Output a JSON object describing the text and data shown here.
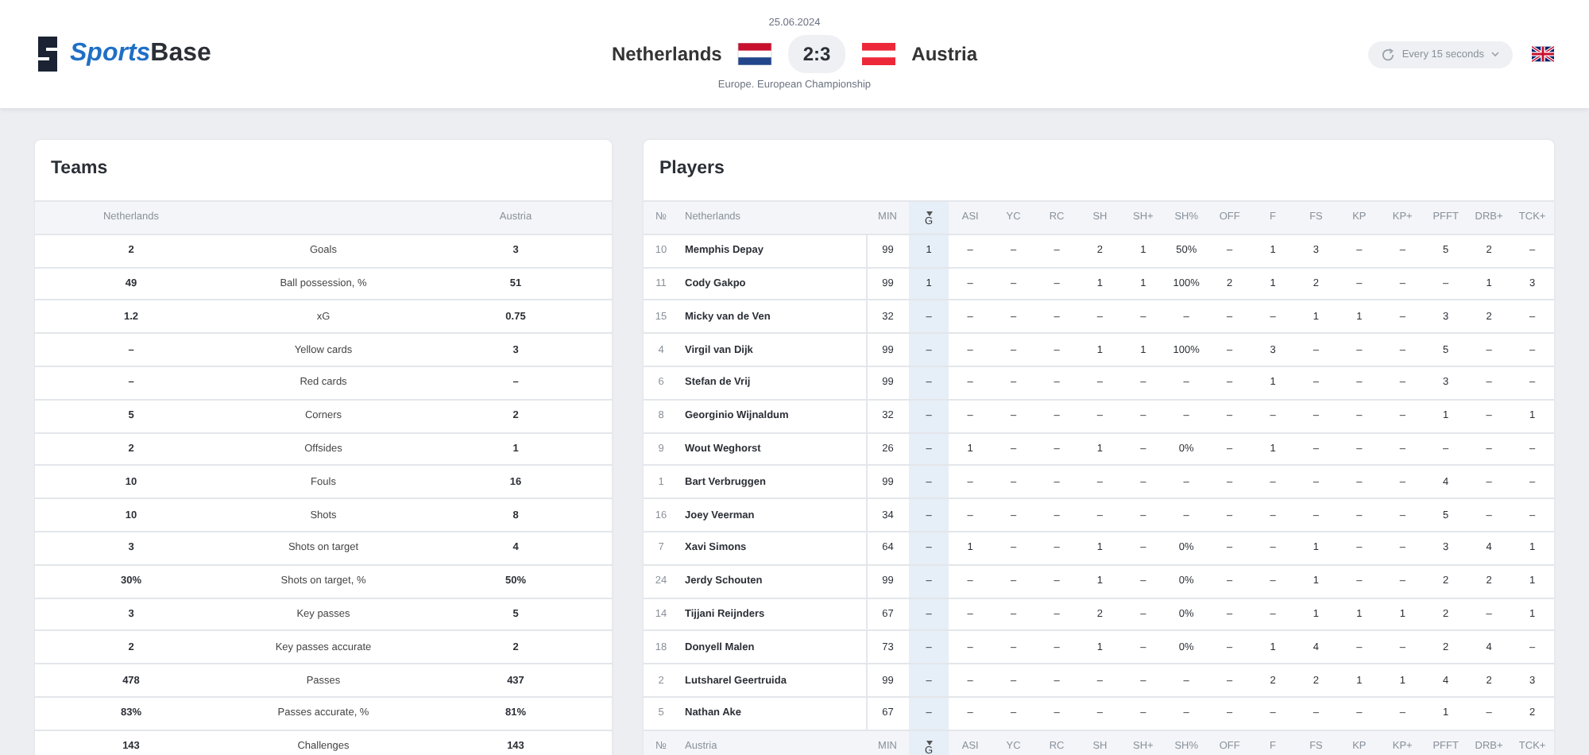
{
  "header": {
    "logo": {
      "first": "Sports",
      "second": "Base"
    },
    "date": "25.06.2024",
    "home_team": "Netherlands",
    "score": "2:3",
    "away_team": "Austria",
    "competition": "Europe. European Championship",
    "refresh": "Every 15 seconds"
  },
  "teams": {
    "title": "Teams",
    "home_label": "Netherlands",
    "away_label": "Austria",
    "rows": [
      {
        "home": "2",
        "stat": "Goals",
        "away": "3"
      },
      {
        "home": "49",
        "stat": "Ball possession, %",
        "away": "51"
      },
      {
        "home": "1.2",
        "stat": "xG",
        "away": "0.75"
      },
      {
        "home": "–",
        "stat": "Yellow cards",
        "away": "3"
      },
      {
        "home": "–",
        "stat": "Red cards",
        "away": "–"
      },
      {
        "home": "5",
        "stat": "Corners",
        "away": "2"
      },
      {
        "home": "2",
        "stat": "Offsides",
        "away": "1"
      },
      {
        "home": "10",
        "stat": "Fouls",
        "away": "16"
      },
      {
        "home": "10",
        "stat": "Shots",
        "away": "8"
      },
      {
        "home": "3",
        "stat": "Shots on target",
        "away": "4"
      },
      {
        "home": "30%",
        "stat": "Shots on target, %",
        "away": "50%"
      },
      {
        "home": "3",
        "stat": "Key passes",
        "away": "5"
      },
      {
        "home": "2",
        "stat": "Key passes accurate",
        "away": "2"
      },
      {
        "home": "478",
        "stat": "Passes",
        "away": "437"
      },
      {
        "home": "83%",
        "stat": "Passes accurate, %",
        "away": "81%"
      },
      {
        "home": "143",
        "stat": "Challenges",
        "away": "143"
      }
    ]
  },
  "players": {
    "title": "Players",
    "home": {
      "columns": [
        {
          "label": "№",
          "sorted": false
        },
        {
          "label": "Netherlands",
          "sorted": false
        },
        {
          "label": "MIN",
          "sorted": false
        },
        {
          "label": "G",
          "sorted": true
        },
        {
          "label": "ASI",
          "sorted": false
        },
        {
          "label": "YC",
          "sorted": false
        },
        {
          "label": "RC",
          "sorted": false
        },
        {
          "label": "SH",
          "sorted": false
        },
        {
          "label": "SH+",
          "sorted": false
        },
        {
          "label": "SH%",
          "sorted": false
        },
        {
          "label": "OFF",
          "sorted": false
        },
        {
          "label": "F",
          "sorted": false
        },
        {
          "label": "FS",
          "sorted": false
        },
        {
          "label": "KP",
          "sorted": false
        },
        {
          "label": "KP+",
          "sorted": false
        },
        {
          "label": "PFFT",
          "sorted": false
        },
        {
          "label": "DRB+",
          "sorted": false
        },
        {
          "label": "TCK+",
          "sorted": false
        }
      ],
      "rows": [
        [
          "10",
          "Memphis Depay",
          "99",
          "1",
          "–",
          "–",
          "–",
          "2",
          "1",
          "50%",
          "–",
          "1",
          "3",
          "–",
          "–",
          "5",
          "2",
          "–"
        ],
        [
          "11",
          "Cody Gakpo",
          "99",
          "1",
          "–",
          "–",
          "–",
          "1",
          "1",
          "100%",
          "2",
          "1",
          "2",
          "–",
          "–",
          "–",
          "1",
          "3"
        ],
        [
          "15",
          "Micky van de Ven",
          "32",
          "–",
          "–",
          "–",
          "–",
          "–",
          "–",
          "–",
          "–",
          "–",
          "1",
          "1",
          "–",
          "3",
          "2",
          "–"
        ],
        [
          "4",
          "Virgil van Dijk",
          "99",
          "–",
          "–",
          "–",
          "–",
          "1",
          "1",
          "100%",
          "–",
          "3",
          "–",
          "–",
          "–",
          "5",
          "–",
          "–"
        ],
        [
          "6",
          "Stefan de Vrij",
          "99",
          "–",
          "–",
          "–",
          "–",
          "–",
          "–",
          "–",
          "–",
          "1",
          "–",
          "–",
          "–",
          "3",
          "–",
          "–"
        ],
        [
          "8",
          "Georginio Wijnaldum",
          "32",
          "–",
          "–",
          "–",
          "–",
          "–",
          "–",
          "–",
          "–",
          "–",
          "–",
          "–",
          "–",
          "1",
          "–",
          "1"
        ],
        [
          "9",
          "Wout Weghorst",
          "26",
          "–",
          "1",
          "–",
          "–",
          "1",
          "–",
          "0%",
          "–",
          "1",
          "–",
          "–",
          "–",
          "–",
          "–",
          "–"
        ],
        [
          "1",
          "Bart Verbruggen",
          "99",
          "–",
          "–",
          "–",
          "–",
          "–",
          "–",
          "–",
          "–",
          "–",
          "–",
          "–",
          "–",
          "4",
          "–",
          "–"
        ],
        [
          "16",
          "Joey Veerman",
          "34",
          "–",
          "–",
          "–",
          "–",
          "–",
          "–",
          "–",
          "–",
          "–",
          "–",
          "–",
          "–",
          "5",
          "–",
          "–"
        ],
        [
          "7",
          "Xavi Simons",
          "64",
          "–",
          "1",
          "–",
          "–",
          "1",
          "–",
          "0%",
          "–",
          "–",
          "1",
          "–",
          "–",
          "3",
          "4",
          "1"
        ],
        [
          "24",
          "Jerdy Schouten",
          "99",
          "–",
          "–",
          "–",
          "–",
          "1",
          "–",
          "0%",
          "–",
          "–",
          "1",
          "–",
          "–",
          "2",
          "2",
          "1"
        ],
        [
          "14",
          "Tijjani Reijnders",
          "67",
          "–",
          "–",
          "–",
          "–",
          "2",
          "–",
          "0%",
          "–",
          "–",
          "1",
          "1",
          "1",
          "2",
          "–",
          "1"
        ],
        [
          "18",
          "Donyell Malen",
          "73",
          "–",
          "–",
          "–",
          "–",
          "1",
          "–",
          "0%",
          "–",
          "1",
          "4",
          "–",
          "–",
          "2",
          "4",
          "–"
        ],
        [
          "2",
          "Lutsharel Geertruida",
          "99",
          "–",
          "–",
          "–",
          "–",
          "–",
          "–",
          "–",
          "–",
          "2",
          "2",
          "1",
          "1",
          "4",
          "2",
          "3"
        ],
        [
          "5",
          "Nathan Ake",
          "67",
          "–",
          "–",
          "–",
          "–",
          "–",
          "–",
          "–",
          "–",
          "–",
          "–",
          "–",
          "–",
          "1",
          "–",
          "2"
        ]
      ]
    },
    "away": {
      "columns": [
        {
          "label": "№",
          "sorted": false
        },
        {
          "label": "Austria",
          "sorted": false
        },
        {
          "label": "MIN",
          "sorted": false
        },
        {
          "label": "G",
          "sorted": true
        },
        {
          "label": "ASI",
          "sorted": false
        },
        {
          "label": "YC",
          "sorted": false
        },
        {
          "label": "RC",
          "sorted": false
        },
        {
          "label": "SH",
          "sorted": false
        },
        {
          "label": "SH+",
          "sorted": false
        },
        {
          "label": "SH%",
          "sorted": false
        },
        {
          "label": "OFF",
          "sorted": false
        },
        {
          "label": "F",
          "sorted": false
        },
        {
          "label": "FS",
          "sorted": false
        },
        {
          "label": "KP",
          "sorted": false
        },
        {
          "label": "KP+",
          "sorted": false
        },
        {
          "label": "PFFT",
          "sorted": false
        },
        {
          "label": "DRB+",
          "sorted": false
        },
        {
          "label": "TCK+",
          "sorted": false
        }
      ]
    }
  }
}
